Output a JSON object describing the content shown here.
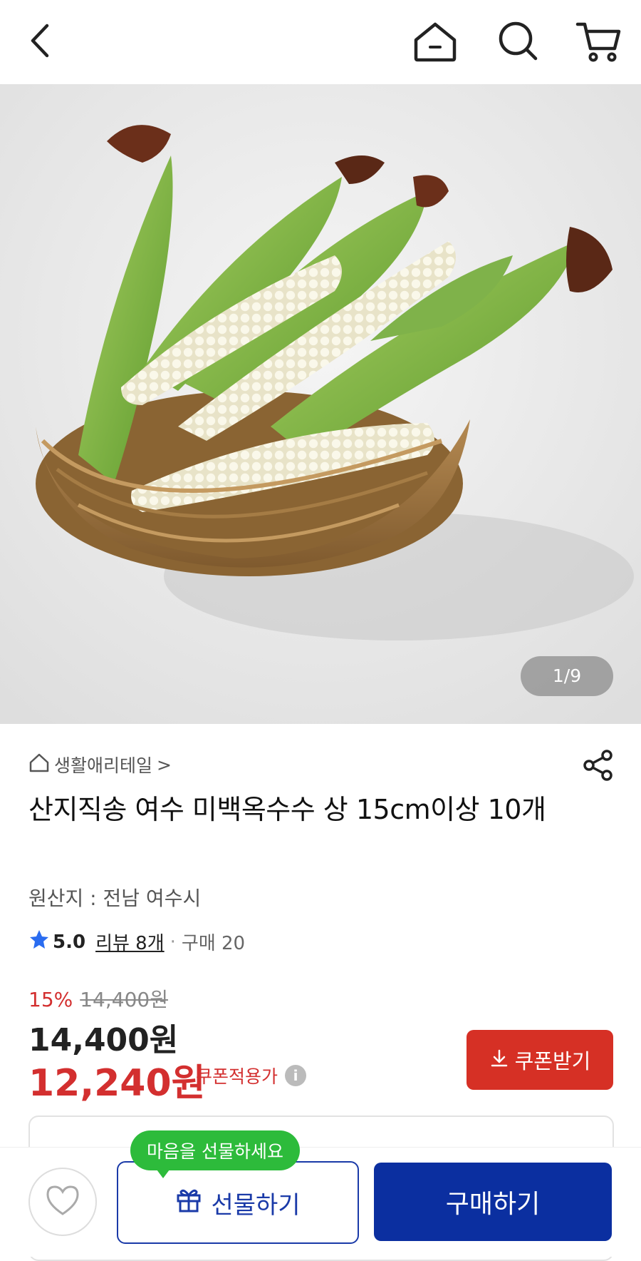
{
  "header": {
    "back_icon": "chevron-left-icon",
    "home_icon": "home-icon",
    "search_icon": "search-icon",
    "cart_icon": "cart-icon"
  },
  "gallery": {
    "counter": "1/9"
  },
  "product": {
    "breadcrumb": "생활애리테일",
    "breadcrumb_arrow": ">",
    "title": "산지직송 여수 미백옥수수 상 15cm이상 10개",
    "origin": "원산지 : 전남 여수시",
    "rating": "5.0",
    "review_label": "리뷰 8개",
    "separator": "·",
    "purchase_label": "구매 20"
  },
  "price": {
    "discount_rate": "15%",
    "original_price": "14,400원",
    "sale_price": "14,400원",
    "coupon_price": "12,240원",
    "coupon_label": "쿠폰적용가",
    "coupon_button": "쿠폰받기"
  },
  "bottom": {
    "tooltip": "마음을 선물하세요",
    "gift_button": "선물하기",
    "buy_button": "구매하기"
  },
  "colors": {
    "accent_red": "#d63025",
    "primary_blue": "#0b2fa0",
    "tooltip_green": "#2dbb3b"
  }
}
